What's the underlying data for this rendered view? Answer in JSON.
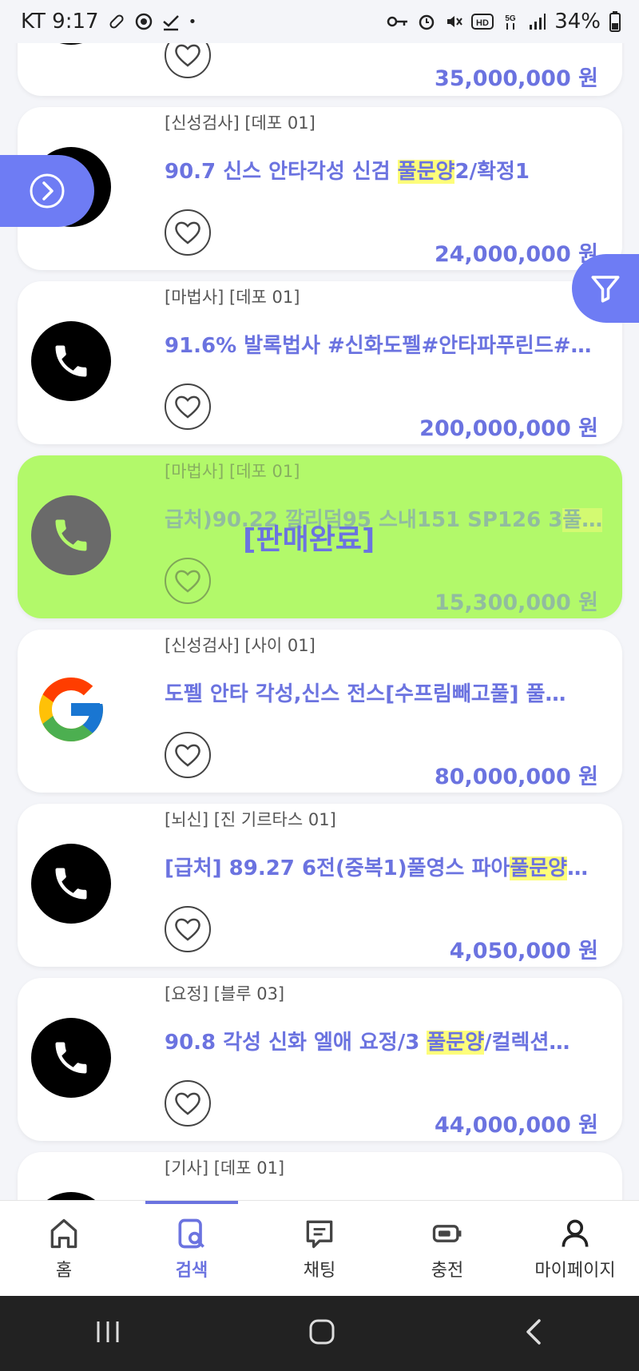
{
  "status": {
    "carrier_time": "KT 9:17",
    "battery": "34%"
  },
  "listings": [
    {
      "category": "",
      "title": "",
      "price": "35,000,000 원",
      "avatar": "phone-icon",
      "sold": false
    },
    {
      "category": "[신성검사] [데포 01]",
      "title_parts": [
        "90.7 신스 안타각성 신검 ",
        "풀문양",
        "2/확정1"
      ],
      "price": "24,000,000 원",
      "avatar": "phone-icon",
      "sold": false
    },
    {
      "category": "[마법사] [데포 01]",
      "title": "91.6% 발록법사 #신화도펠#안타파푸린드#…",
      "price": "200,000,000 원",
      "avatar": "phone-icon",
      "sold": false
    },
    {
      "category": "[마법사] [데포 01]",
      "title_parts": [
        "급처)90.22 깔리덤95 스내151 SP126 3",
        "풀…"
      ],
      "price": "15,300,000 원",
      "avatar": "phone-icon",
      "sold": true,
      "sold_label": "[판매완료]"
    },
    {
      "category": "[신성검사] [사이 01]",
      "title": "도펠 안타 각성,신스 전스[수프림빼고풀] 풀…",
      "price": "80,000,000 원",
      "avatar": "google-icon",
      "sold": false
    },
    {
      "category": "[뇌신] [진 기르타스 01]",
      "title_parts": [
        "[급처] 89.27 6전(중복1)풀영스 파아",
        "풀문양",
        "…"
      ],
      "price": "4,050,000 원",
      "avatar": "phone-icon",
      "sold": false
    },
    {
      "category": "[요정] [블루 03]",
      "title_parts": [
        "90.8 각성 신화 엘애 요정/3 ",
        "풀문양",
        "/컬렉션…"
      ],
      "price": "44,000,000 원",
      "avatar": "phone-icon",
      "sold": false
    },
    {
      "category": "[기사] [데포 01]",
      "title": "",
      "price": "",
      "avatar": "phone-icon",
      "sold": false
    }
  ],
  "nav": {
    "home": "홈",
    "search": "검색",
    "chat": "채팅",
    "charge": "충전",
    "mypage": "마이페이지",
    "active": "search"
  },
  "colors": {
    "accent": "#6b73e0",
    "fab": "#6e7cf4",
    "sold_bg": "#b2f96a",
    "highlight": "#fdfd7a"
  }
}
